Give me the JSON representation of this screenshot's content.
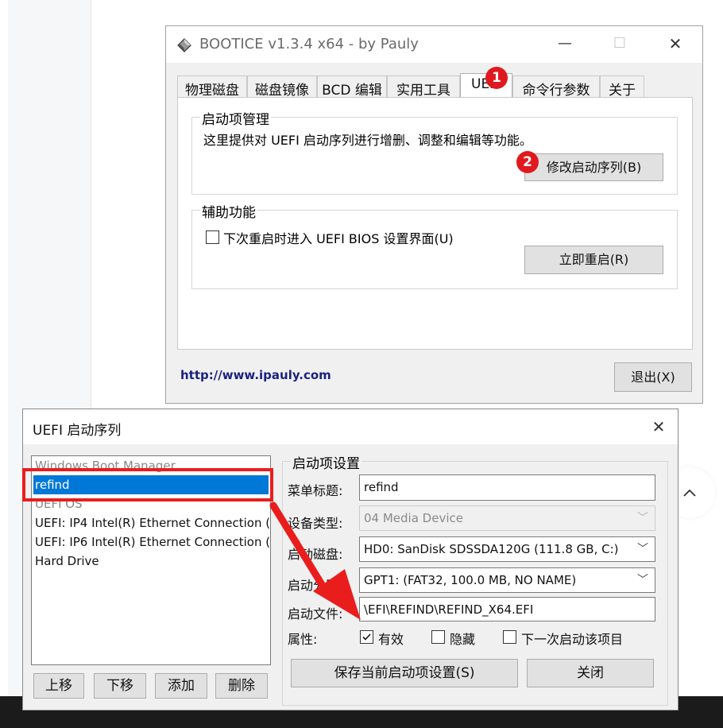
{
  "background": {
    "scroll_top_icon": "chevron-up-icon"
  },
  "bootice": {
    "title": "BOOTICE v1.3.4 x64 - by Pauly",
    "controls": {
      "minimize": "—",
      "maximize": "☐",
      "close": "✕"
    },
    "tabs": [
      "物理磁盘",
      "磁盘镜像",
      "BCD 编辑",
      "实用工具",
      "UEFI",
      "命令行参数",
      "关于"
    ],
    "active_tab": "UEFI",
    "boot_group": {
      "label": "启动项管理",
      "description": "这里提供对 UEFI 启动序列进行增删、调整和编辑等功能。",
      "edit_button": "修改启动序列(B)"
    },
    "aux_group": {
      "label": "辅助功能",
      "checkbox_label": "下次重启时进入 UEFI BIOS 设置界面(U)",
      "restart_button": "立即重启(R)"
    },
    "url": "http://www.ipauly.com",
    "exit_button": "退出(X)"
  },
  "badges": [
    "1",
    "2"
  ],
  "uefi_dialog": {
    "title": "UEFI 启动序列",
    "close": "✕",
    "entries": [
      "Windows Boot Manager",
      "refind",
      "UEFI OS",
      "UEFI: IP4 Intel(R) Ethernet Connection (",
      "UEFI: IP6 Intel(R) Ethernet Connection (",
      "Hard Drive"
    ],
    "selected_entry": "refind",
    "list_buttons": [
      "上移",
      "下移",
      "添加",
      "删除"
    ],
    "settings": {
      "group_label": "启动项设置",
      "menu_title_label": "菜单标题:",
      "menu_title_value": "refind",
      "device_type_label": "设备类型:",
      "device_type_value": "04 Media Device",
      "boot_disk_label": "启动磁盘:",
      "boot_disk_value": "HD0: SanDisk SDSSDA120G (111.8 GB, C:)",
      "boot_partition_label": "启动分区:",
      "boot_partition_value": "GPT1: (FAT32, 100.0 MB, NO NAME)",
      "boot_file_label": "启动文件:",
      "boot_file_value": "\\EFI\\REFIND\\REFIND_X64.EFI",
      "attributes_label": "属性:",
      "attr_valid": "有效",
      "attr_hidden": "隐藏",
      "attr_next_boot": "下一次启动该项目",
      "attr_valid_checked": true,
      "save_button": "保存当前启动项设置(S)",
      "close_button": "关闭"
    }
  },
  "colors": {
    "badge": "#e0191f",
    "highlight": "#ea1d1d",
    "selection": "#0078d7",
    "link": "#1a237e"
  }
}
